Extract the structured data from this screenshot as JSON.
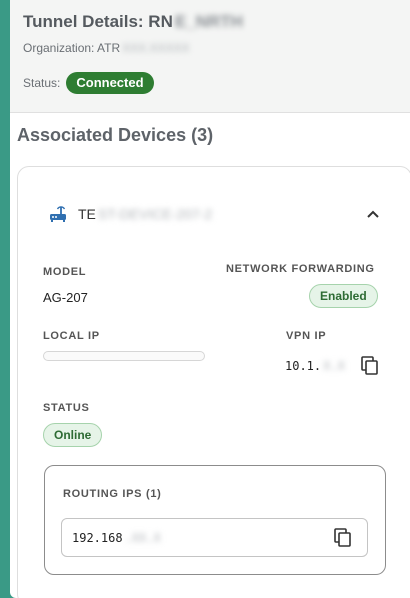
{
  "tunnel": {
    "title_prefix": "Tunnel Details: RN",
    "title_hidden": "E_NRTH",
    "org_label": "Organization: ATR",
    "org_hidden": "XXX.XXXXX",
    "status_label": "Status:",
    "status_value": "Connected"
  },
  "devices": {
    "title": "Associated Devices (3)",
    "device": {
      "name_prefix": "TE",
      "name_hidden": "ST-DEVICE-207-2",
      "model_label": "MODEL",
      "model_value": "AG-207",
      "network_forwarding_label": "NETWORK FORWARDING",
      "network_forwarding_value": "Enabled",
      "local_ip_label": "LOCAL IP",
      "vpn_ip_label": "VPN IP",
      "vpn_ip_prefix": "10.1.",
      "vpn_ip_hidden": "X.X",
      "status_label": "STATUS",
      "status_value": "Online",
      "routing": {
        "label": "ROUTING IPS (1)",
        "ip_prefix": "192.168",
        "ip_hidden": ".XX.X"
      }
    }
  },
  "icons": {
    "router": "router-icon",
    "chevron": "chevron-up-icon",
    "copy": "copy-icon"
  },
  "colors": {
    "background": "#3a9a86",
    "connected": "#2e7d32",
    "chip_bg": "#e6f4e8",
    "chip_text": "#2e6b34",
    "router_icon": "#2f6fb0"
  }
}
